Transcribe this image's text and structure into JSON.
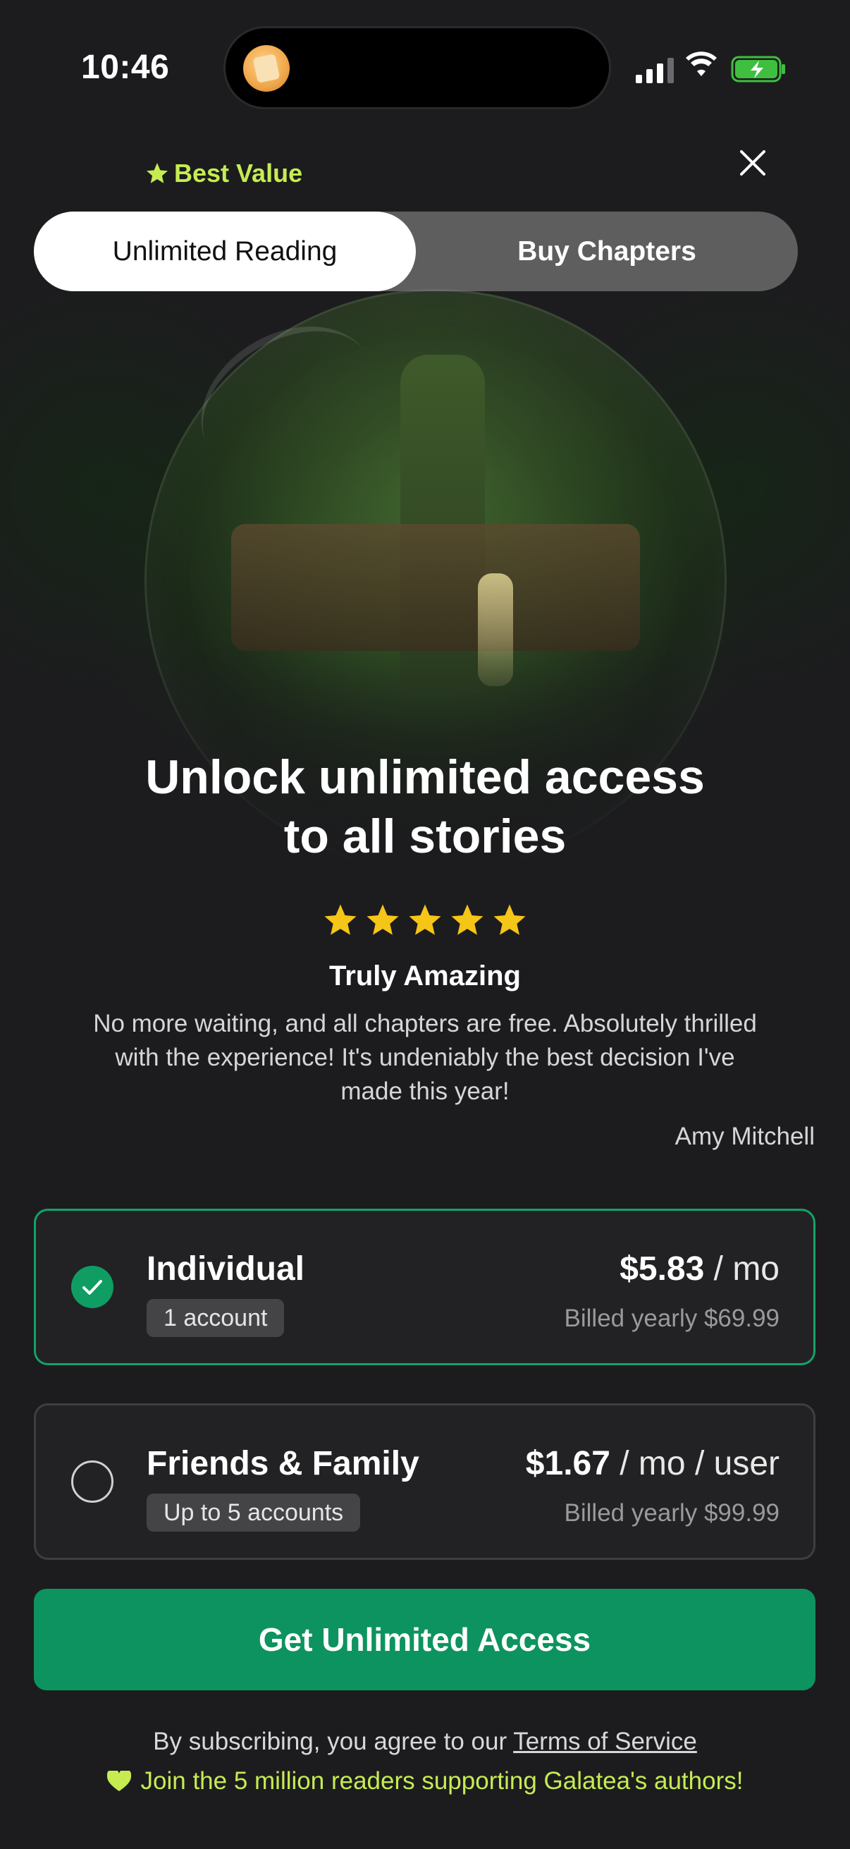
{
  "status_bar": {
    "time": "10:46"
  },
  "header": {
    "badge": "Best Value",
    "tabs": [
      {
        "label": "Unlimited Reading",
        "active": true
      },
      {
        "label": "Buy Chapters",
        "active": false
      }
    ]
  },
  "hero": {
    "headline_line1": "Unlock unlimited access",
    "headline_line2": "to all stories"
  },
  "review": {
    "rating": 5,
    "title": "Truly Amazing",
    "body": "No more waiting, and all chapters are free. Absolutely thrilled with the experience! It's undeniably the best decision I've made this year!",
    "author": "Amy Mitchell"
  },
  "plans": [
    {
      "name": "Individual",
      "tag": "1 account",
      "price": "$5.83",
      "unit": " / mo",
      "billed": "Billed yearly $69.99",
      "selected": true
    },
    {
      "name": "Friends & Family",
      "tag": "Up to 5 accounts",
      "price": "$1.67",
      "unit": " / mo / user",
      "billed": "Billed yearly $99.99",
      "selected": false
    }
  ],
  "cta": {
    "label": "Get Unlimited Access"
  },
  "footer": {
    "terms_prefix": "By subscribing, you agree to our ",
    "terms_link": "Terms of Service",
    "join_text": "Join the 5 million readers supporting Galatea's authors!"
  },
  "colors": {
    "accent_green": "#0d935f",
    "highlight_lime": "#c6ec52",
    "star_yellow": "#f5c518"
  }
}
